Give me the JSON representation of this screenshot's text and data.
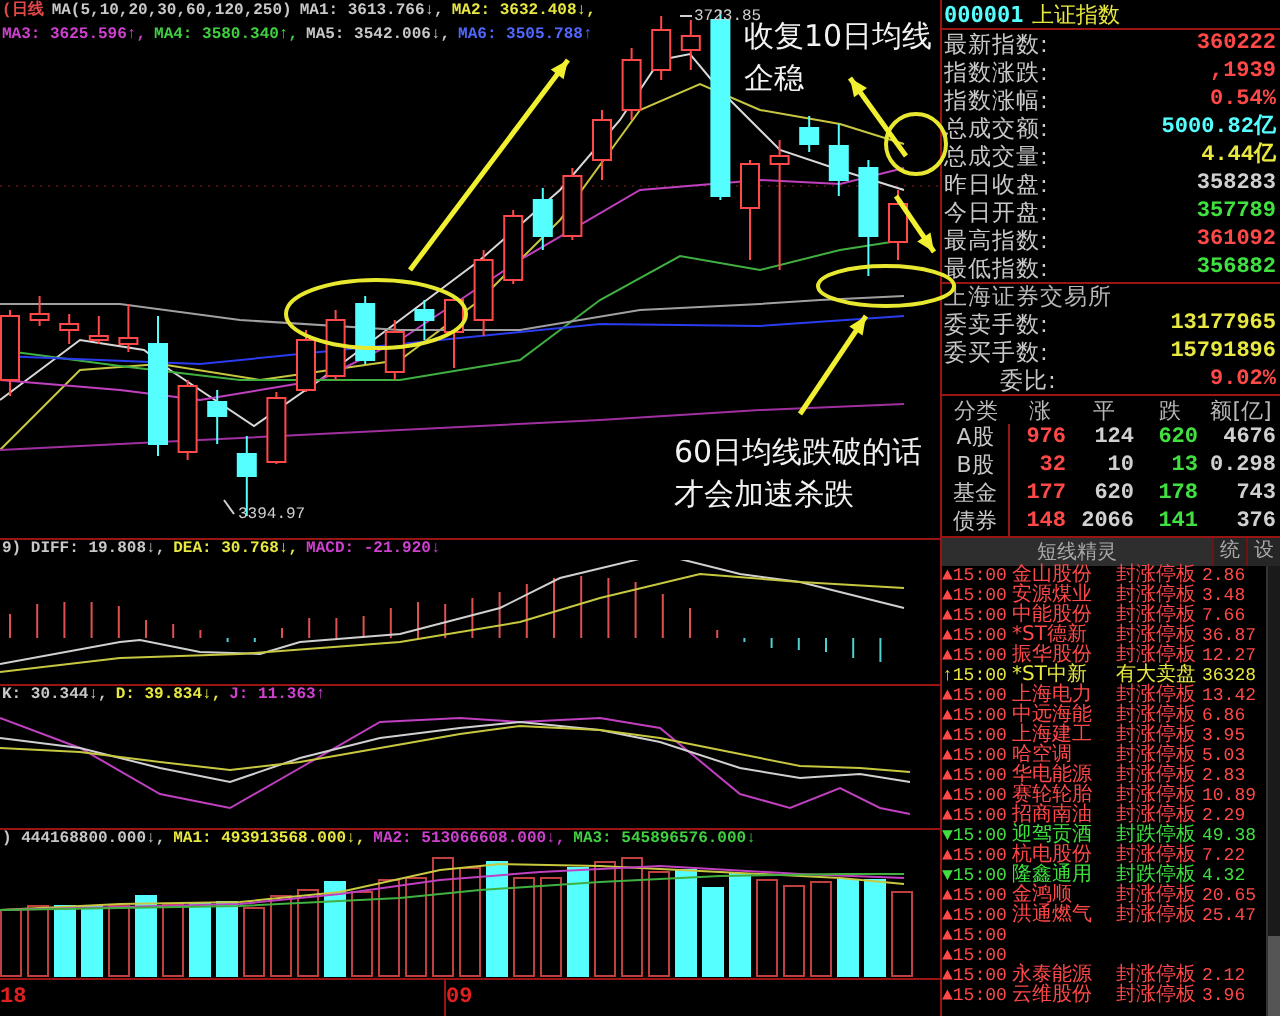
{
  "main_chart": {
    "header": [
      {
        "text": "(日线",
        "color": "#e04848"
      },
      {
        "text": "MA(5,10,20,30,60,120,250)",
        "color": "#c8c8c8"
      },
      {
        "text": "MA1: 3613.766↓,",
        "color": "#c8c8c8"
      },
      {
        "text": "MA2: 3632.408↓,",
        "color": "#e8e840"
      },
      {
        "text": "MA3: 3625.596↑,",
        "color": "#d040d0"
      },
      {
        "text": "MA4: 3580.340↑,",
        "color": "#40d040"
      },
      {
        "text": "MA5: 3542.006↓,",
        "color": "#c8c8c8"
      },
      {
        "text": "MA6: 3505.788↑",
        "color": "#5068ff"
      }
    ],
    "high_label": "3723.85",
    "low_label": "3394.97"
  },
  "annotations": [
    {
      "lines": [
        "收复10日均线",
        "企稳"
      ]
    },
    {
      "lines": [
        "60日均线跌破的话",
        "才会加速杀跌"
      ]
    }
  ],
  "macd_panel": {
    "header": [
      {
        "text": "9) DIFF: 19.808↓,",
        "color": "#c8c8c8"
      },
      {
        "text": "DEA: 30.768↓,",
        "color": "#e8e840"
      },
      {
        "text": "MACD: -21.920↓",
        "color": "#d040d0"
      }
    ]
  },
  "kdj_panel": {
    "header": [
      {
        "text": "K: 30.344↓,",
        "color": "#c8c8c8"
      },
      {
        "text": "D: 39.834↓,",
        "color": "#e8e840"
      },
      {
        "text": "J: 11.363↑",
        "color": "#d040d0"
      }
    ]
  },
  "volume_panel": {
    "header": [
      {
        "text": ") 444168800.000↓,",
        "color": "#c8c8c8"
      },
      {
        "text": "MA1: 493913568.000↓,",
        "color": "#e8e840"
      },
      {
        "text": "MA2: 513066608.000↓,",
        "color": "#d040d0"
      },
      {
        "text": "MA3: 545896576.000↓",
        "color": "#40d040"
      }
    ]
  },
  "date_axis": [
    "18",
    "09"
  ],
  "quote_panel": {
    "code": "000001",
    "name": "上证指数",
    "quotes": [
      {
        "label": "最新指数:",
        "value": "360222",
        "color": "#ff4848"
      },
      {
        "label": "指数涨跌:",
        "value": ",1939",
        "color": "#ff4848"
      },
      {
        "label": "指数涨幅:",
        "value": "0.54%",
        "color": "#ff4848"
      },
      {
        "label": "总成交额:",
        "value": "5000.82亿",
        "color": "#55ffff"
      },
      {
        "label": "总成交量:",
        "value": "4.44亿",
        "color": "#e8e840"
      },
      {
        "label": "昨日收盘:",
        "value": "358283",
        "color": "#d0d0d0"
      },
      {
        "label": "今日开盘:",
        "value": "357789",
        "color": "#40e040"
      },
      {
        "label": "最高指数:",
        "value": "361092",
        "color": "#ff4848"
      },
      {
        "label": "最低指数:",
        "value": "356882",
        "color": "#40e040"
      }
    ],
    "exchange": "上海证券交易所",
    "orders": [
      {
        "label": "委卖手数:",
        "value": "13177965",
        "color": "#e8e840"
      },
      {
        "label": "委买手数:",
        "value": "15791896",
        "color": "#e8e840"
      },
      {
        "label": "委比:",
        "value": "9.02%",
        "color": "#ff4848"
      }
    ],
    "breadth": {
      "columns": [
        "分类",
        "涨",
        "平",
        "跌",
        "额[亿]"
      ],
      "rows": [
        {
          "category": "A股",
          "rise": "976",
          "flat": "124",
          "fall": "620",
          "amount": "4676"
        },
        {
          "category": "B股",
          "rise": "32",
          "flat": "10",
          "fall": "13",
          "amount": "0.298"
        },
        {
          "category": "基金",
          "rise": "177",
          "flat": "620",
          "fall": "178",
          "amount": "743"
        },
        {
          "category": "债券",
          "rise": "148",
          "flat": "2066",
          "fall": "141",
          "amount": "376"
        }
      ]
    }
  },
  "alerts": {
    "title": "短线精灵",
    "buttons": [
      "统",
      "设"
    ],
    "items": [
      {
        "kind": "up",
        "marker": "▲",
        "time": "15:00",
        "name": "金山股份",
        "event": "封涨停板",
        "value": "2.86"
      },
      {
        "kind": "up",
        "marker": "▲",
        "time": "15:00",
        "name": "安源煤业",
        "event": "封涨停板",
        "value": "3.48"
      },
      {
        "kind": "up",
        "marker": "▲",
        "time": "15:00",
        "name": "中能股份",
        "event": "封涨停板",
        "value": "7.66"
      },
      {
        "kind": "up",
        "marker": "▲",
        "time": "15:00",
        "name": "*ST德新",
        "event": "封涨停板",
        "value": "36.87"
      },
      {
        "kind": "up",
        "marker": "▲",
        "time": "15:00",
        "name": "振华股份",
        "event": "封涨停板",
        "value": "12.27"
      },
      {
        "kind": "sell",
        "marker": "↑",
        "time": "15:00",
        "name": "*ST中新",
        "event": "有大卖盘",
        "value": "36328"
      },
      {
        "kind": "up",
        "marker": "▲",
        "time": "15:00",
        "name": "上海电力",
        "event": "封涨停板",
        "value": "13.42"
      },
      {
        "kind": "up",
        "marker": "▲",
        "time": "15:00",
        "name": "中远海能",
        "event": "封涨停板",
        "value": "6.86"
      },
      {
        "kind": "up",
        "marker": "▲",
        "time": "15:00",
        "name": "上海建工",
        "event": "封涨停板",
        "value": "3.95"
      },
      {
        "kind": "up",
        "marker": "▲",
        "time": "15:00",
        "name": "哈空调",
        "event": "封涨停板",
        "value": "5.03"
      },
      {
        "kind": "up",
        "marker": "▲",
        "time": "15:00",
        "name": "华电能源",
        "event": "封涨停板",
        "value": "2.83"
      },
      {
        "kind": "up",
        "marker": "▲",
        "time": "15:00",
        "name": "赛轮轮胎",
        "event": "封涨停板",
        "value": "10.89"
      },
      {
        "kind": "up",
        "marker": "▲",
        "time": "15:00",
        "name": "招商南油",
        "event": "封涨停板",
        "value": "2.29"
      },
      {
        "kind": "down",
        "marker": "▼",
        "time": "15:00",
        "name": "迎驾贡酒",
        "event": "封跌停板",
        "value": "49.38"
      },
      {
        "kind": "up",
        "marker": "▲",
        "time": "15:00",
        "name": "杭电股份",
        "event": "封涨停板",
        "value": "7.22"
      },
      {
        "kind": "down",
        "marker": "▼",
        "time": "15:00",
        "name": "隆鑫通用",
        "event": "封跌停板",
        "value": "4.32"
      },
      {
        "kind": "up",
        "marker": "▲",
        "time": "15:00",
        "name": "金鸿顺",
        "event": "封涨停板",
        "value": "20.65"
      },
      {
        "kind": "up",
        "marker": "▲",
        "time": "15:00",
        "name": "洪通燃气",
        "event": "封涨停板",
        "value": "25.47"
      },
      {
        "kind": "up",
        "marker": "▲",
        "time": "15:00"
      },
      {
        "kind": "up",
        "marker": "▲",
        "time": "15:00"
      },
      {
        "kind": "up",
        "marker": "▲",
        "time": "15:00",
        "name": "永泰能源",
        "event": "封涨停板",
        "value": "2.12"
      },
      {
        "kind": "up",
        "marker": "▲",
        "time": "15:00",
        "name": "云维股份",
        "event": "封涨停板",
        "value": "3.96"
      }
    ]
  }
}
